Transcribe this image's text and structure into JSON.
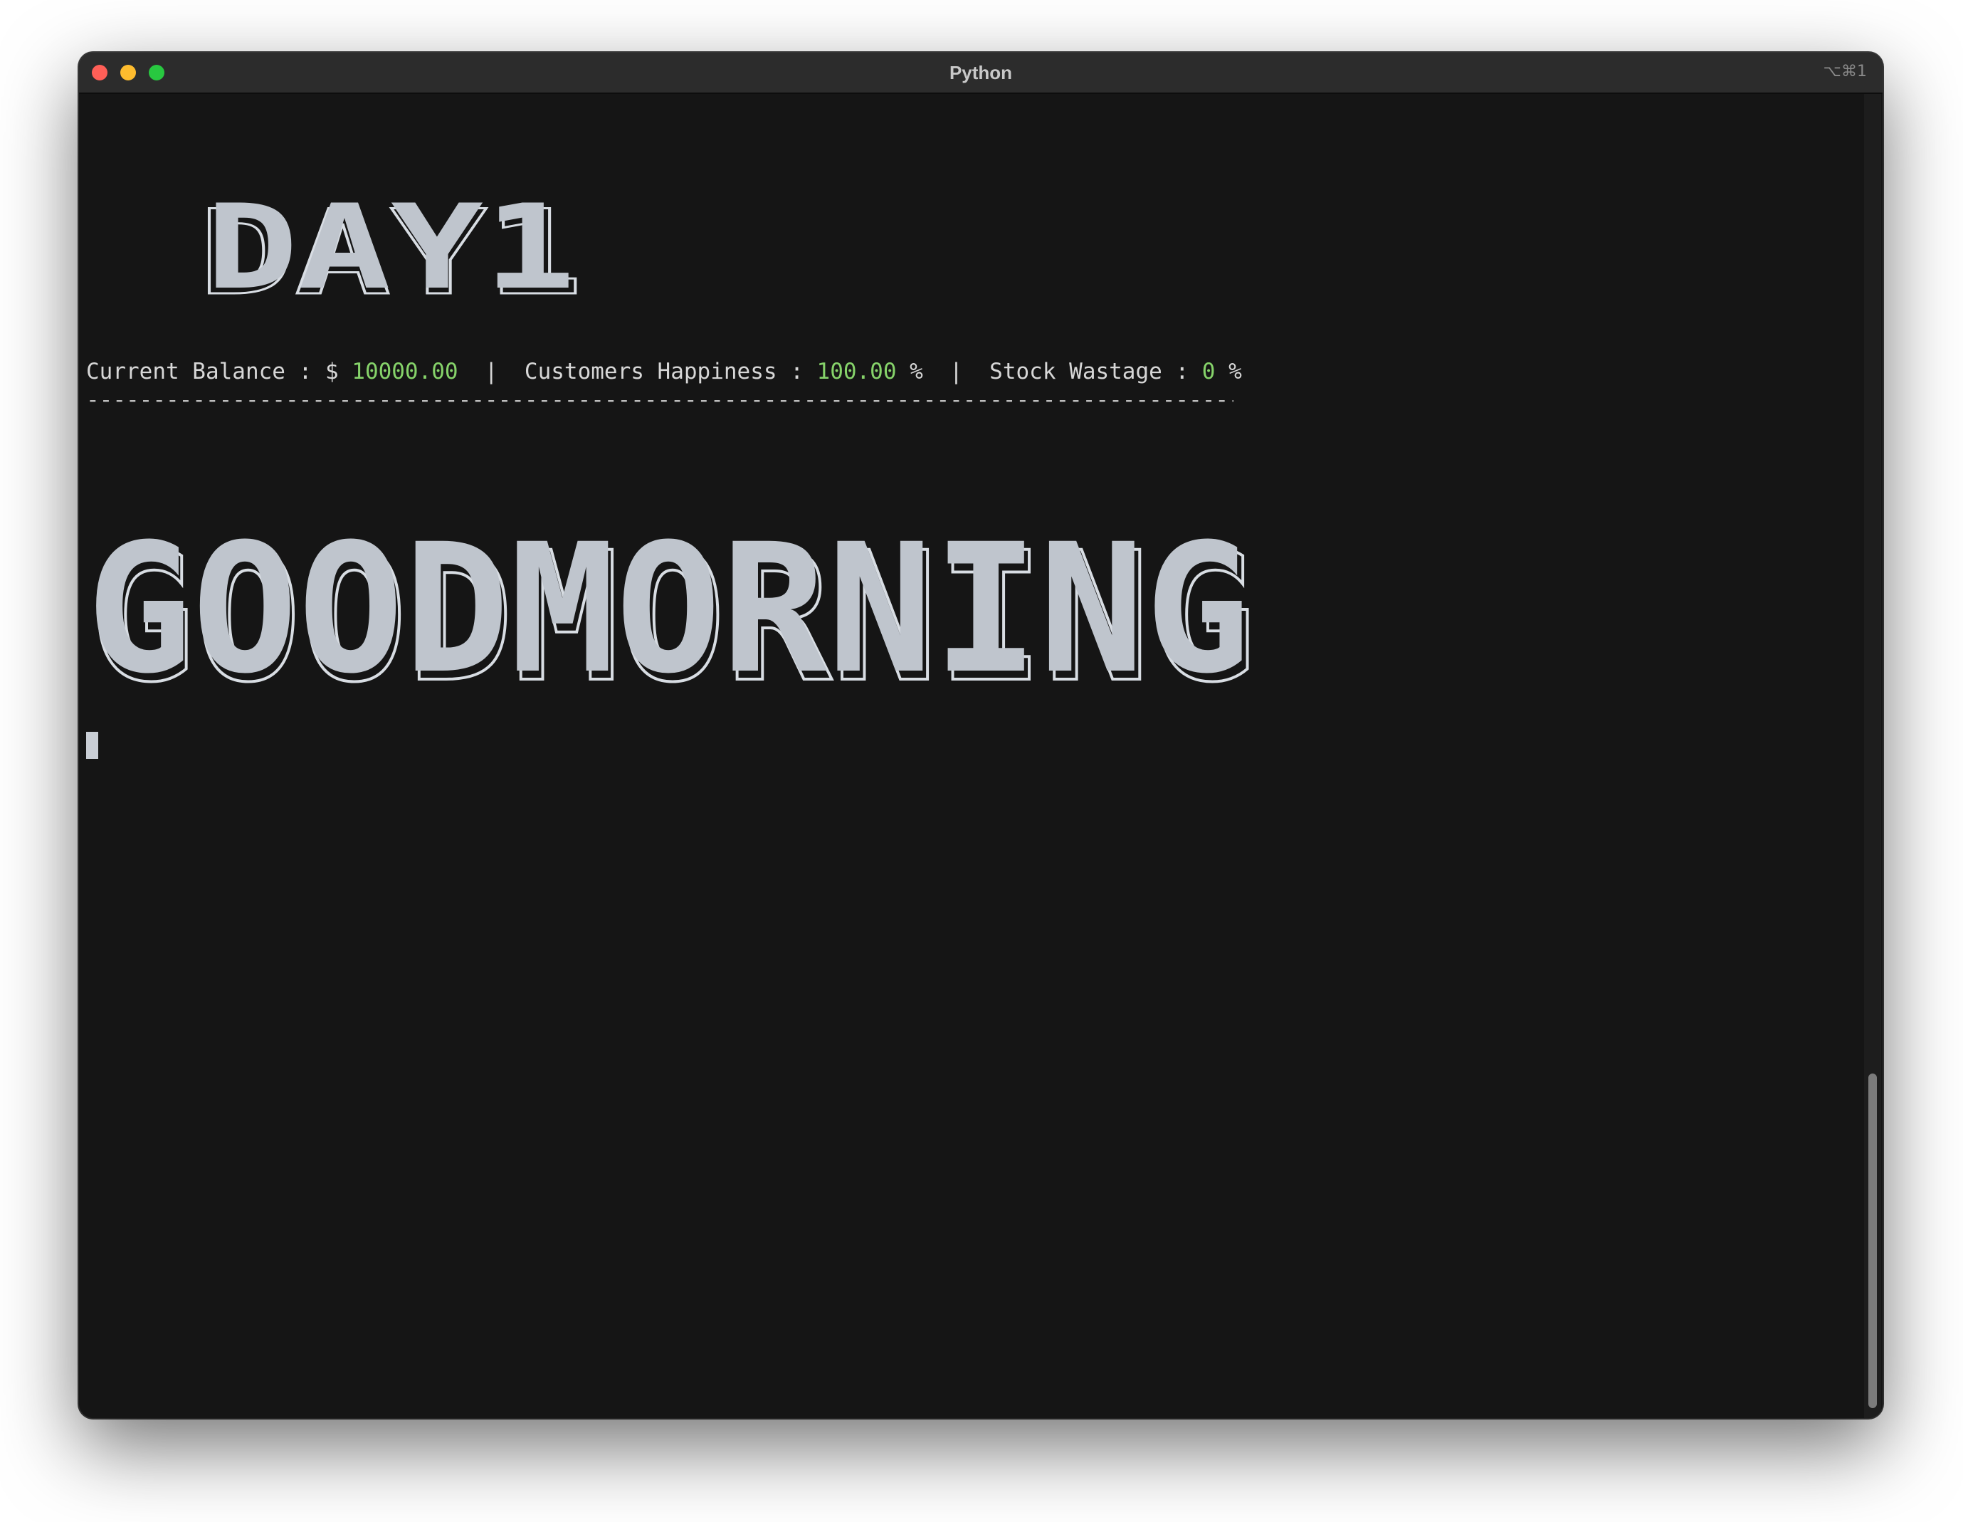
{
  "window": {
    "title": "Python",
    "shortcut": "⌥⌘1",
    "traffic_lights": {
      "close": "#ff5f57",
      "minimize": "#febc2e",
      "maximize": "#28c840"
    }
  },
  "terminal": {
    "day_banner": "DAY1",
    "status": {
      "balance_label": "Current Balance : $ ",
      "balance_value": "10000.00",
      "separator_1": "  |  ",
      "happiness_label": "Customers Happiness : ",
      "happiness_value": "100.00",
      "happiness_unit": " %",
      "separator_2": "  |  ",
      "wastage_label": "Stock Wastage : ",
      "wastage_value": "0",
      "wastage_unit": " %"
    },
    "divider": "-------------------------------------------------------------------------------------------------------------------------",
    "greeting_banner": "GOODMORNING"
  },
  "colors": {
    "background": "#151515",
    "text": "#d7d7d7",
    "value_green": "#86d36a",
    "banner": "#bfc5cd"
  }
}
